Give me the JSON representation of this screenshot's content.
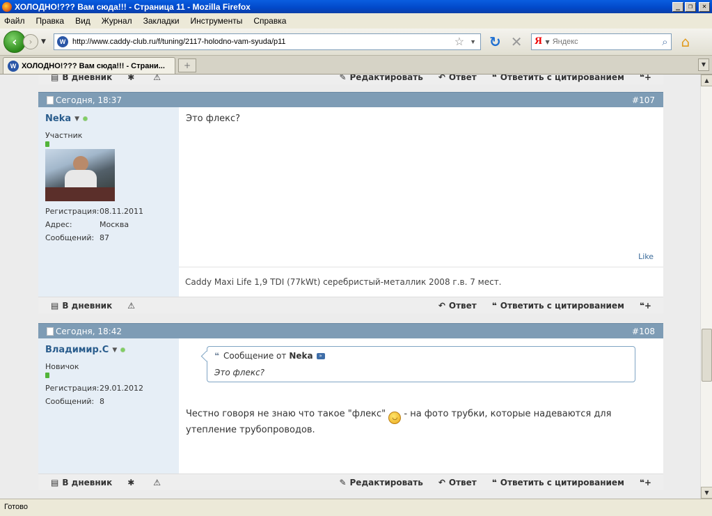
{
  "window": {
    "title": "ХОЛОДНО!??? Вам сюда!!! - Страница 11 - Mozilla Firefox",
    "minimize": "_",
    "restore": "❐",
    "close": "✕"
  },
  "menu": {
    "items": [
      "Файл",
      "Правка",
      "Вид",
      "Журнал",
      "Закладки",
      "Инструменты",
      "Справка"
    ]
  },
  "nav": {
    "url": "http://www.caddy-club.ru/f/tuning/2117-holodno-vam-syuda/p11",
    "search_placeholder": "Яндекс",
    "search_engine": "Я"
  },
  "tabs": [
    {
      "label": "ХОЛОДНО!??? Вам сюда!!! - Страни..."
    }
  ],
  "actions": {
    "diary": "В дневник",
    "edit": "Редактировать",
    "reply": "Ответ",
    "quote_reply": "Ответить с цитированием"
  },
  "posts": [
    {
      "date": "Сегодня, 18:37",
      "number": "#107",
      "username": "Neka",
      "usertitle": "Участник",
      "registration_label": "Регистрация:",
      "registration": "08.11.2011",
      "address_label": "Адрес:",
      "address": "Москва",
      "messages_label": "Сообщений:",
      "messages": "87",
      "text": "Это флекс?",
      "like": "Like",
      "signature": "Caddy Maxi Life 1,9 TDI (77kWt) серебристый-металлик 2008 г.в. 7 мест."
    },
    {
      "date": "Сегодня, 18:42",
      "number": "#108",
      "username": "Владимир.С",
      "usertitle": "Новичок",
      "registration_label": "Регистрация:",
      "registration": "29.01.2012",
      "messages_label": "Сообщений:",
      "messages": "8",
      "quote_from": "Сообщение от",
      "quote_author": "Neka",
      "quote_text": "Это флекс?",
      "text_part1": "Честно говоря не знаю что такое \"флекс\"",
      "text_part2": "- на фото трубки, которые надеваются для утепление трубопроводов."
    }
  ],
  "status": {
    "text": "Готово"
  }
}
